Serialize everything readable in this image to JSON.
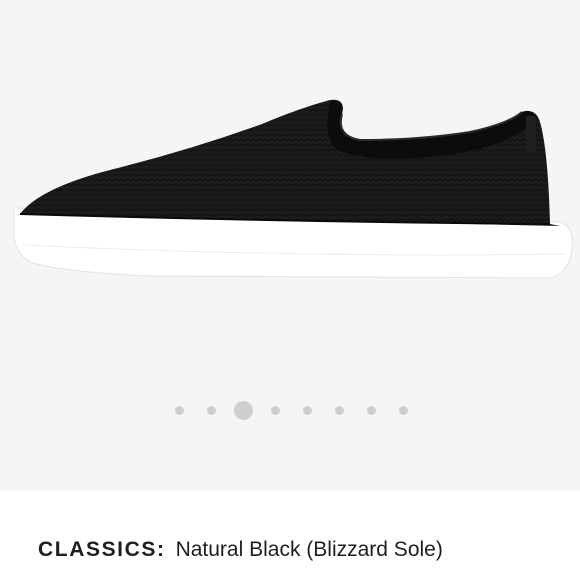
{
  "product": {
    "collection_label": "CLASSICS:",
    "color_name": "Natural Black (Blizzard Sole)",
    "image_icon": "slip-on-sneaker-image"
  },
  "carousel": {
    "dot_count": 8,
    "active_index": 2
  },
  "colors": {
    "background": "#f5f5f5",
    "upper": "#141414",
    "sole": "#ffffff",
    "dot": "#cfcfcf",
    "text": "#1e1e1e"
  }
}
